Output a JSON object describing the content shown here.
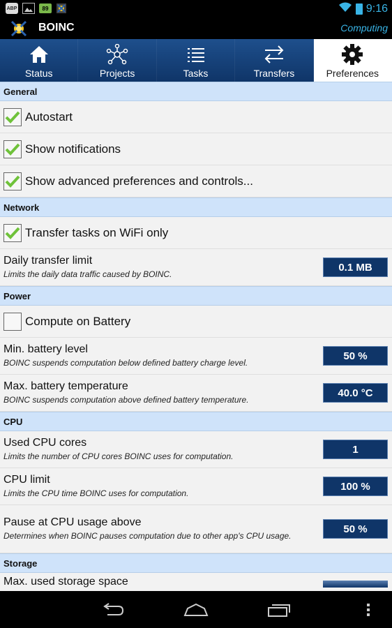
{
  "status_bar": {
    "time": "9:16",
    "left_icons": [
      "abp-icon",
      "image-notification-icon",
      "battery-notification-icon",
      "boinc-notification-icon"
    ],
    "abp_label": "ABP",
    "battery_notification_label": "89"
  },
  "app": {
    "title": "BOINC",
    "status": "Computing"
  },
  "tabs": [
    {
      "label": "Status",
      "icon": "home-icon",
      "active": false
    },
    {
      "label": "Projects",
      "icon": "network-icon",
      "active": false
    },
    {
      "label": "Tasks",
      "icon": "list-icon",
      "active": false
    },
    {
      "label": "Transfers",
      "icon": "transfer-arrows-icon",
      "active": false
    },
    {
      "label": "Preferences",
      "icon": "gear-icon",
      "active": true
    }
  ],
  "sections": {
    "general": {
      "header": "General",
      "autostart": {
        "label": "Autostart",
        "checked": true
      },
      "notifications": {
        "label": "Show notifications",
        "checked": true
      },
      "advanced": {
        "label": "Show advanced preferences and controls...",
        "checked": true
      }
    },
    "network": {
      "header": "Network",
      "wifi_only": {
        "label": "Transfer tasks on WiFi only",
        "checked": true
      },
      "daily_limit": {
        "title": "Daily transfer limit",
        "desc": "Limits the daily data traffic caused by BOINC.",
        "value": "0.1 MB"
      }
    },
    "power": {
      "header": "Power",
      "compute_battery": {
        "label": "Compute on Battery",
        "checked": false
      },
      "min_battery": {
        "title": "Min. battery level",
        "desc": "BOINC suspends computation below defined battery charge level.",
        "value": "50 %"
      },
      "max_temp": {
        "title": "Max. battery temperature",
        "desc": "BOINC suspends computation above defined battery temperature.",
        "value": "40.0 °C"
      }
    },
    "cpu": {
      "header": "CPU",
      "cores": {
        "title": "Used CPU cores",
        "desc": "Limits the number of CPU cores BOINC uses for computation.",
        "value": "1"
      },
      "limit": {
        "title": "CPU limit",
        "desc": "Limits the CPU time BOINC uses for computation.",
        "value": "100 %"
      },
      "pause": {
        "title": "Pause at CPU usage above",
        "desc": "Determines when BOINC pauses computation due to other app's CPU usage.",
        "value": "50 %"
      }
    },
    "storage": {
      "header": "Storage",
      "max_storage": {
        "title": "Max. used storage space"
      }
    }
  },
  "colors": {
    "accent_blue": "#39b4e6",
    "tab_bar": "#0f3568",
    "section_header": "#cfe3fa",
    "checkmark_green": "#6fc23a"
  }
}
